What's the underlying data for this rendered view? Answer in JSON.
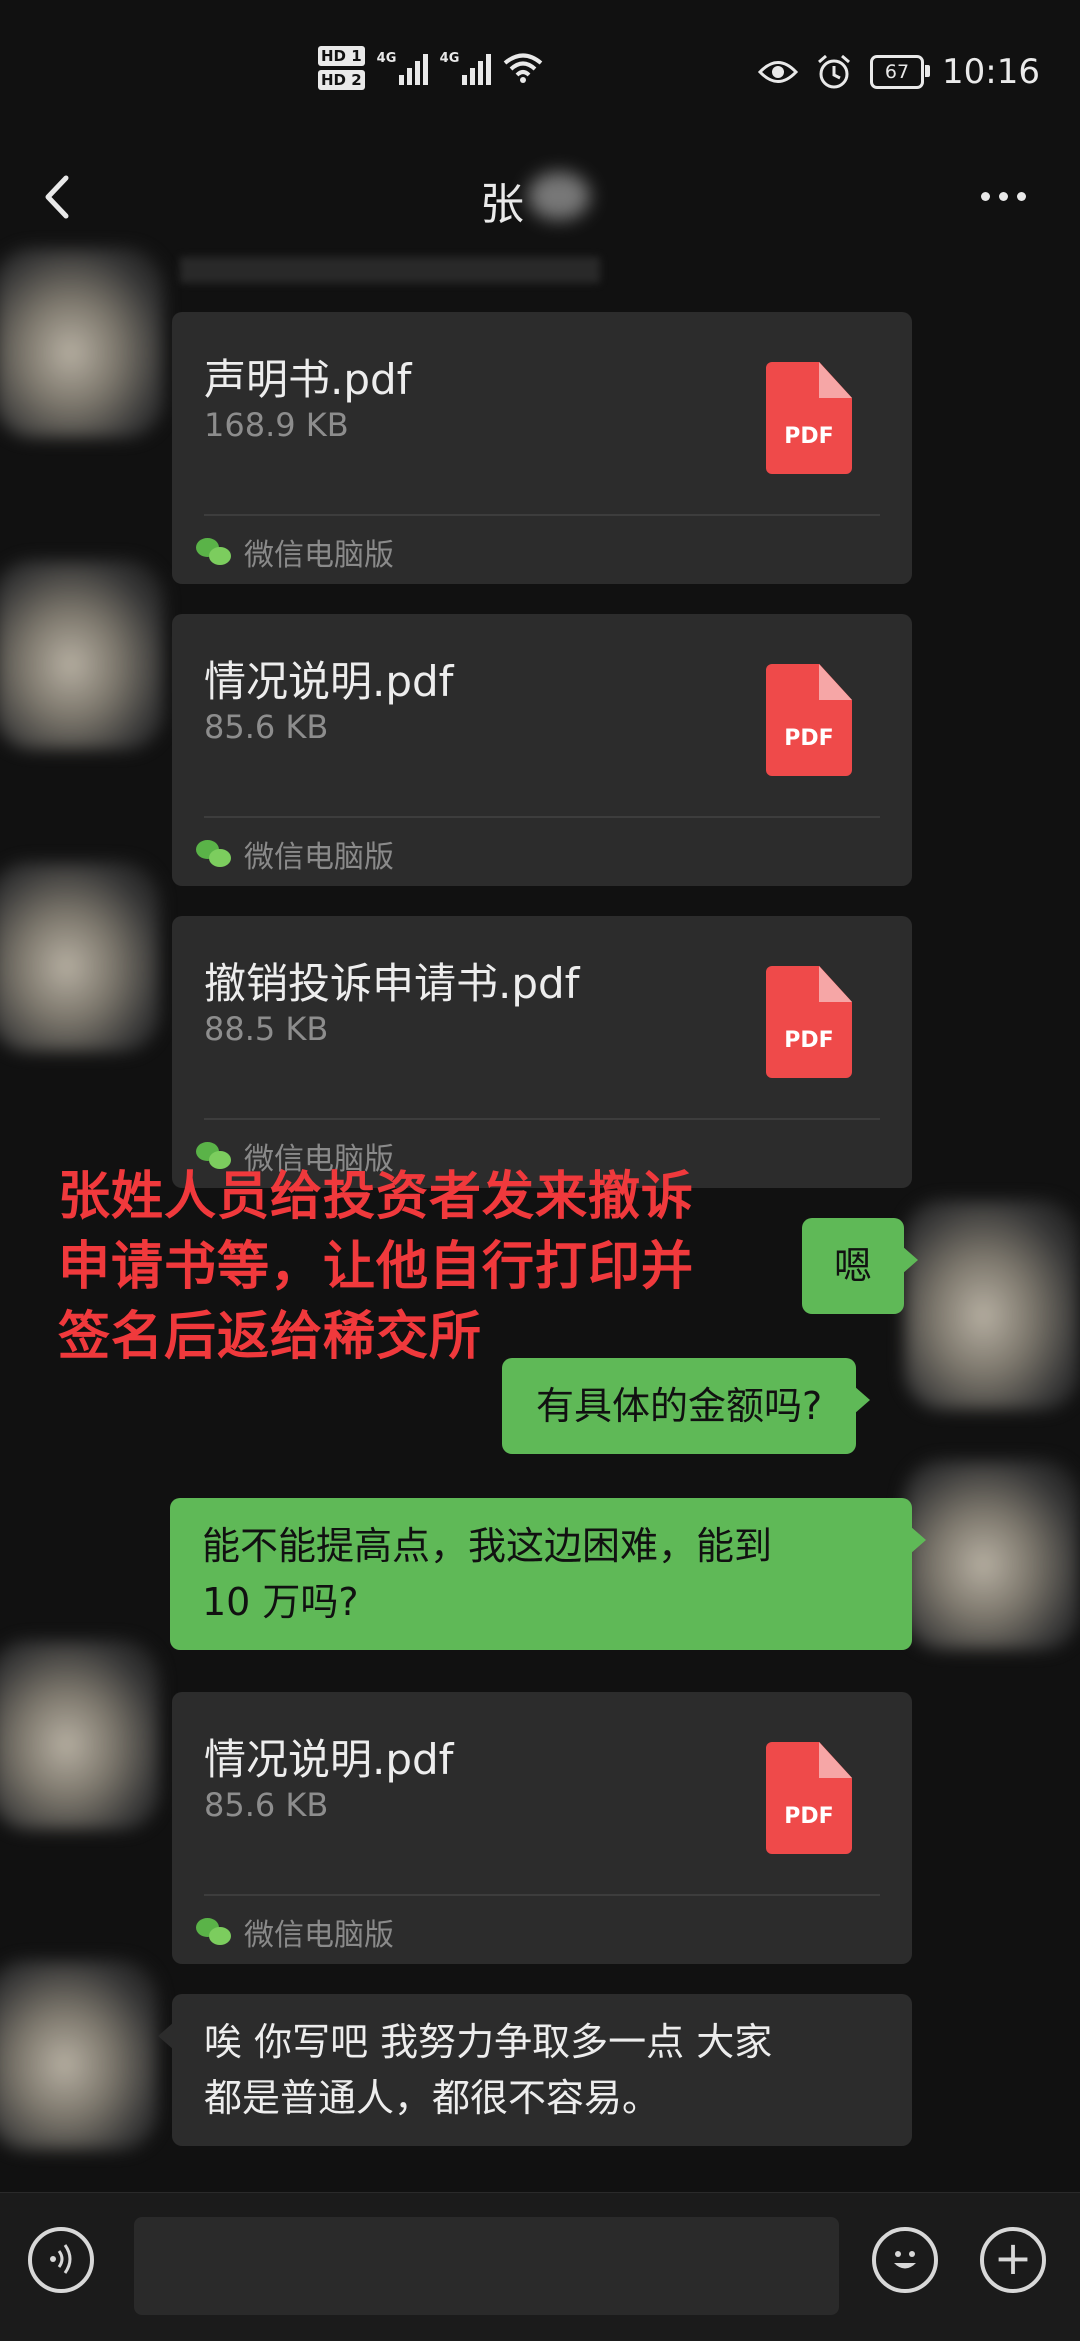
{
  "status_bar": {
    "hd1": "HD 1",
    "hd2": "HD 2",
    "network1": "4G",
    "network2": "4G",
    "battery": "67",
    "time": "10:16",
    "icons": [
      "signal-icon",
      "wifi-icon",
      "eye-icon",
      "alarm-icon",
      "battery-icon"
    ]
  },
  "nav": {
    "title": "张"
  },
  "messages": {
    "file1": {
      "name": "声明书.pdf",
      "size": "168.9 KB",
      "type_label": "PDF",
      "source": "微信电脑版"
    },
    "file2": {
      "name": "情况说明.pdf",
      "size": "85.6 KB",
      "type_label": "PDF",
      "source": "微信电脑版"
    },
    "file3": {
      "name": "撤销投诉申请书.pdf",
      "size": "88.5 KB",
      "type_label": "PDF",
      "source": "微信电脑版"
    },
    "sent1": "嗯",
    "sent2": "有具体的金额吗?",
    "sent3_line1": "能不能提高点，我这边困难，能到",
    "sent3_line2": "10 万吗?",
    "file4": {
      "name": "情况说明.pdf",
      "size": "85.6 KB",
      "type_label": "PDF",
      "source": "微信电脑版"
    },
    "recv1_line1": "唉 你写吧 我努力争取多一点 大家",
    "recv1_line2": "都是普通人，都很不容易。"
  },
  "overlay": {
    "line1": "张姓人员给投资者发来撤诉",
    "line2": "申请书等，让他自行打印并",
    "line3": "签名后返给稀交所",
    "color": "#f0393c"
  },
  "input_bar": {
    "placeholder": ""
  },
  "colors": {
    "background": "#111111",
    "bubble_sent": "#5fb957",
    "bubble_recv": "#2c2c2c",
    "pdf_red": "#ef4a4a"
  }
}
